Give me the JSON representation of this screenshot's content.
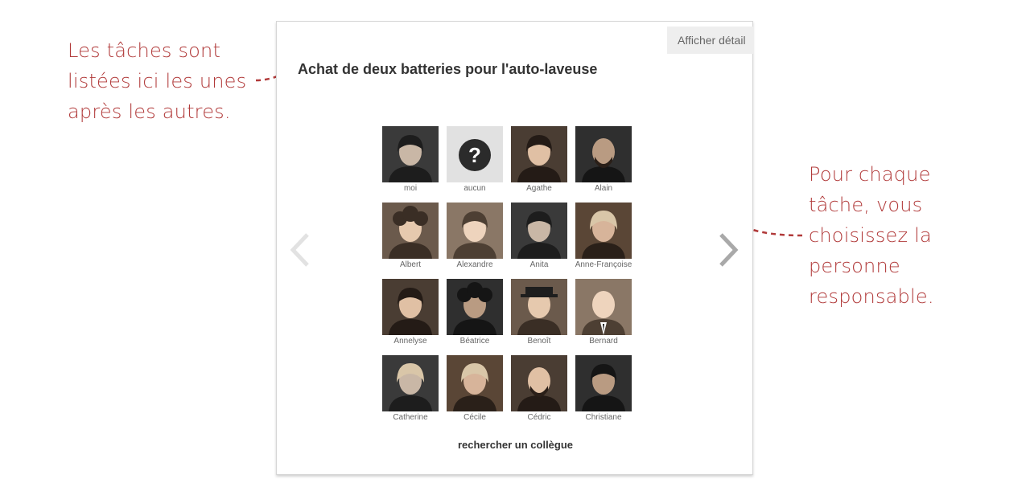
{
  "card": {
    "detail_button_label": "Afficher détail",
    "task_title": "Achat de deux batteries pour l'auto-laveuse",
    "search_link_label": "rechercher un collègue",
    "people": [
      {
        "name": "moi",
        "avatar": "person-dark-hair"
      },
      {
        "name": "aucun",
        "avatar": "question-icon"
      },
      {
        "name": "Agathe",
        "avatar": "person-dark-hair"
      },
      {
        "name": "Alain",
        "avatar": "person-beard"
      },
      {
        "name": "Albert",
        "avatar": "person-curly-hair"
      },
      {
        "name": "Alexandre",
        "avatar": "person-dark-hair"
      },
      {
        "name": "Anita",
        "avatar": "person-dark-hair"
      },
      {
        "name": "Anne-Françoise",
        "avatar": "person-light-hair"
      },
      {
        "name": "Annelyse",
        "avatar": "person-dark-hair"
      },
      {
        "name": "Béatrice",
        "avatar": "person-curly-hair"
      },
      {
        "name": "Benoît",
        "avatar": "person-hat"
      },
      {
        "name": "Bernard",
        "avatar": "person-suit"
      },
      {
        "name": "Catherine",
        "avatar": "person-light-hair"
      },
      {
        "name": "Cécile",
        "avatar": "person-light-hair"
      },
      {
        "name": "Cédric",
        "avatar": "person-beard"
      },
      {
        "name": "Christiane",
        "avatar": "person-dark-hair"
      }
    ]
  },
  "annotations": {
    "left_note": [
      "Les tâches sont",
      "listées ici les unes",
      "après les autres."
    ],
    "right_note": [
      "Pour chaque",
      "tâche, vous",
      "choisissez la",
      "personne",
      "responsable."
    ]
  },
  "colors": {
    "annotation": "#b13a3a",
    "button_bg": "#eeeeee",
    "text_dark": "#333333"
  }
}
